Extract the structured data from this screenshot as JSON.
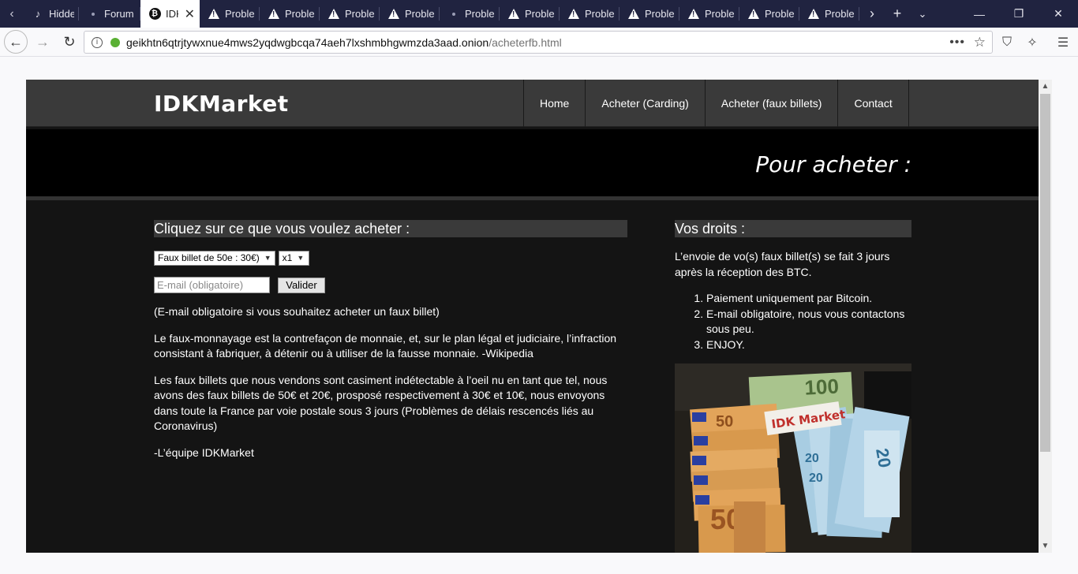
{
  "browser": {
    "tabs": [
      {
        "label": "Hidde",
        "icon": "music-note-icon"
      },
      {
        "label": "Forum",
        "icon": "dot-icon"
      },
      {
        "label": "IDK",
        "icon": "bitcoin-icon",
        "active": true
      },
      {
        "label": "Proble",
        "icon": "warning-icon"
      },
      {
        "label": "Proble",
        "icon": "warning-icon"
      },
      {
        "label": "Proble",
        "icon": "warning-icon"
      },
      {
        "label": "Proble",
        "icon": "warning-icon"
      },
      {
        "label": "Proble",
        "icon": "dot-icon"
      },
      {
        "label": "Proble",
        "icon": "warning-icon"
      },
      {
        "label": "Proble",
        "icon": "warning-icon"
      },
      {
        "label": "Proble",
        "icon": "warning-icon"
      },
      {
        "label": "Proble",
        "icon": "warning-icon"
      },
      {
        "label": "Proble",
        "icon": "warning-icon"
      },
      {
        "label": "Proble",
        "icon": "warning-icon"
      }
    ],
    "url_host": "geikhtn6qtrjtywxnue4mws2yqdwgbcqa74aeh7lxshmbhgwmzda3aad.onion",
    "url_path": "/acheterfb.html"
  },
  "site": {
    "logo": "IDKMarket",
    "nav": [
      "Home",
      "Acheter (Carding)",
      "Acheter (faux billets)",
      "Contact"
    ],
    "banner_title": "Pour acheter :"
  },
  "main": {
    "heading": "Cliquez sur ce que vous voulez acheter :",
    "product_select": "Faux billet de 50e : 30€)",
    "quantity_select": "x1",
    "email_placeholder": "E-mail (obligatoire)",
    "submit_label": "Valider",
    "paragraphs": [
      "(E-mail obligatoire si vous souhaitez acheter un faux billet)",
      "Le faux-monnayage est la contrefaçon de monnaie, et, sur le plan légal et judiciaire, l’infraction consistant à fabriquer, à détenir ou à utiliser de la fausse monnaie. -Wikipedia",
      "Les faux billets que nous vendons sont casiment indétectable à l’oeil nu en tant que tel, nous avons des faux billets de 50€ et 20€, prosposé respectivement à 30€ et 10€, nous envoyons dans toute la France par voie postale sous 3 jours (Problèmes de délais rescencés liés au Coronavirus)",
      "-L’équipe IDKMarket"
    ]
  },
  "sidebar": {
    "heading": "Vos droits :",
    "intro": "L’envoie de vo(s) faux billet(s) se fait 3 jours après la réception des BTC.",
    "rights": [
      "Paiement uniquement par Bitcoin.",
      "E-mail obligatoire, nous vous contactons sous peu.",
      "ENJOY."
    ],
    "photo_sign": "IDK Market",
    "photo_notes": [
      "100",
      "50",
      "20"
    ]
  }
}
